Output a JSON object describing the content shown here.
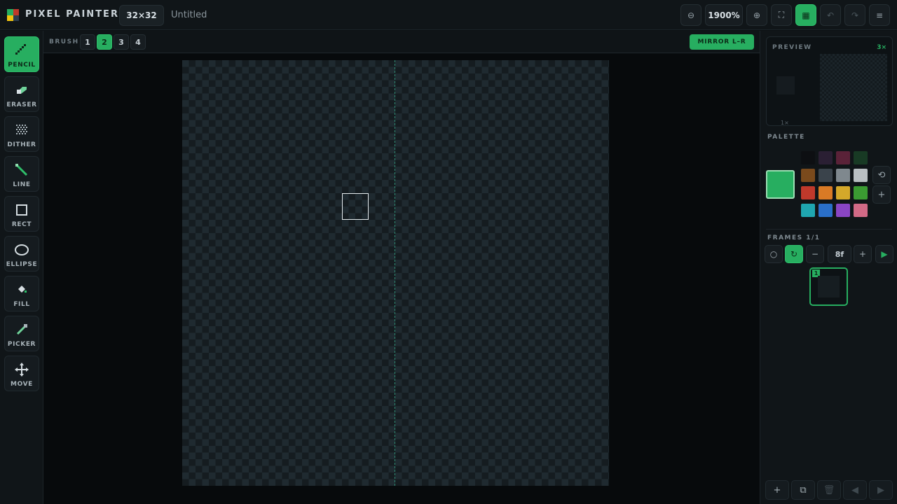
{
  "app": {
    "title": "PIXEL PAINTER",
    "canvas_size": "32×32",
    "file_name": "Untitled"
  },
  "logo_colors": [
    "#27ae60",
    "#c0392b",
    "#f1c40f",
    "#2c3e50"
  ],
  "toolbar": {
    "zoom_out_icon": "⊖",
    "zoom_value": "1900%",
    "zoom_in_icon": "⊕",
    "fit_icon": "⛶",
    "grid_icon": "▦",
    "undo_icon": "↶",
    "redo_icon": "↷",
    "menu_icon": "≡",
    "grid_active": true
  },
  "tools": [
    {
      "id": "pencil",
      "label": "PENCIL",
      "active": true
    },
    {
      "id": "eraser",
      "label": "ERASER",
      "active": false
    },
    {
      "id": "dither",
      "label": "DITHER",
      "active": false
    },
    {
      "id": "line",
      "label": "LINE",
      "active": false
    },
    {
      "id": "rect",
      "label": "RECT",
      "active": false
    },
    {
      "id": "ellipse",
      "label": "ELLIPSE",
      "active": false
    },
    {
      "id": "fill",
      "label": "FILL",
      "active": false
    },
    {
      "id": "picker",
      "label": "PICKER",
      "active": false
    },
    {
      "id": "move",
      "label": "MOVE",
      "active": false
    }
  ],
  "brush": {
    "label": "BRUSH",
    "sizes": [
      "1",
      "2",
      "3",
      "4"
    ],
    "selected": "2",
    "mirror_label": "MIRROR L–R"
  },
  "preview": {
    "label": "PREVIEW",
    "zoom": "3×",
    "small_label": "1×"
  },
  "palette": {
    "label": "PALETTE",
    "current_color": "#27ae60",
    "swatches": [
      "#0d0f12",
      "#2a1f33",
      "#5a2238",
      "#183a24",
      "#7a4a1c",
      "#3a434b",
      "#7f888e",
      "#b9bfc2",
      "#c0392b",
      "#d97a25",
      "#d4a82a",
      "#3b9b32",
      "#1fa6b0",
      "#2a6fc9",
      "#8a45c4",
      "#d26a86"
    ],
    "reset_icon": "⟲",
    "add_icon": "+"
  },
  "frames": {
    "label": "FRAMES 1/1",
    "onion_icon": "○",
    "loop_icon": "↻",
    "minus_icon": "−",
    "fps": "8f",
    "plus_icon": "+",
    "play_icon": "▶",
    "current_frame_number": "1"
  },
  "frame_actions": {
    "add_icon": "+",
    "duplicate_icon": "⧉",
    "delete_icon": "🗑",
    "prev_icon": "◀",
    "next_icon": "▶"
  }
}
